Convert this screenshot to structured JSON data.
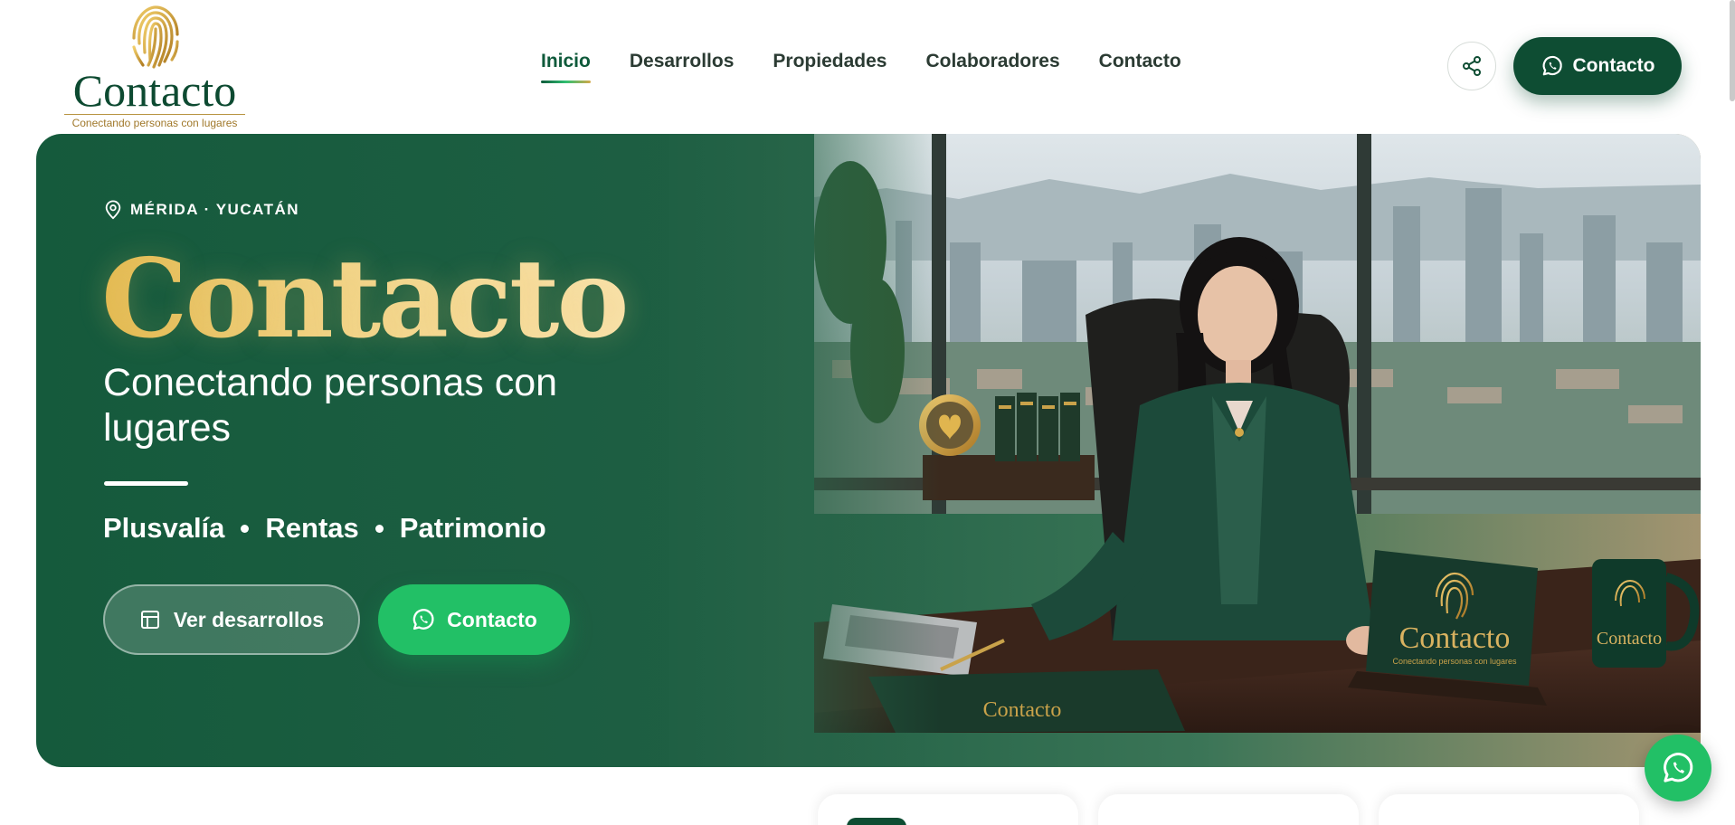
{
  "header": {
    "logo": {
      "word": "Contacto",
      "tagline": "Conectando personas con lugares"
    },
    "nav": [
      {
        "label": "Inicio",
        "active": true
      },
      {
        "label": "Desarrollos",
        "active": false
      },
      {
        "label": "Propiedades",
        "active": false
      },
      {
        "label": "Colaboradores",
        "active": false
      },
      {
        "label": "Contacto",
        "active": false
      }
    ],
    "share_icon": "share-icon",
    "contact_button_label": "Contacto"
  },
  "hero": {
    "location": "MÉRIDA · YUCATÁN",
    "brand": "Contacto",
    "slogan": "Conectando personas con lugares",
    "pillars": [
      "Plusvalía",
      "Rentas",
      "Patrimonio"
    ],
    "primary_button_label": "Ver desarrollos",
    "secondary_button_label": "Contacto",
    "photo": {
      "plaque_word": "Contacto",
      "plaque_tagline": "Conectando personas con lugares",
      "mug_word": "Contacto",
      "folder_word": "Contacto"
    }
  },
  "colors": {
    "brand_green": "#0e4d33",
    "whatsapp_green": "#22c066",
    "gold": "#d4a94a"
  }
}
